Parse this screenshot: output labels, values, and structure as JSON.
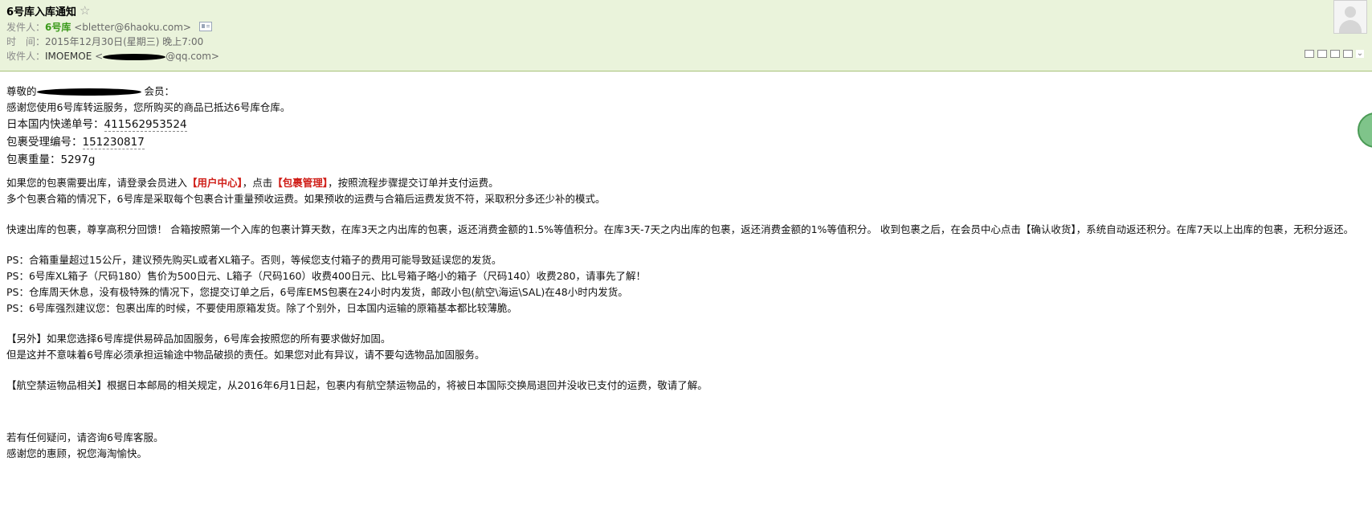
{
  "header": {
    "subject": "6号库入库通知",
    "star_icon": "☆",
    "from_label": "发件人：",
    "sender_name": "6号库",
    "sender_email": "<bletter@6haoku.com>",
    "time_label": "时　间：",
    "time_value": "2015年12月30日(星期三) 晚上7:00",
    "to_label": "收件人：",
    "recipient_name": "IMOEMOE",
    "recipient_email_prefix": "<",
    "recipient_email_suffix": "@qq.com>",
    "toolbar_icons": [
      "expand-icon",
      "window-icon",
      "print-icon",
      "more-caret-icon"
    ]
  },
  "body": {
    "greeting_prefix": "尊敬的",
    "greeting_suffix": " 会员：",
    "line_thanks": "感谢您使用6号库转运服务，您所购买的商品已抵达6号库仓库。",
    "tracking_label": "日本国内快递单号：",
    "tracking_number": "411562953524",
    "parcel_id_label": "包裹受理编号：",
    "parcel_id": "151230817",
    "weight_label": "包裹重量：",
    "weight": "5297g",
    "p1_a": "如果您的包裹需要出库，请登录会员进入",
    "p1_link1": "【用户中心】",
    "p1_b": "，点击",
    "p1_link2": "【包裹管理】",
    "p1_c": "，按照流程步骤提交订单并支付运费。",
    "p2": "多个包裹合箱的情况下，6号库是采取每个包裹合计重量预收运费。如果预收的运费与合箱后运费发货不符，采取积分多还少补的模式。",
    "p3": "快速出库的包裹，尊享高积分回馈！ 合箱按照第一个入库的包裹计算天数，在库3天之内出库的包裹，返还消费金额的1.5%等值积分。在库3天-7天之内出库的包裹，返还消费金额的1%等值积分。 收到包裹之后，在会员中心点击【确认收货】，系统自动返还积分。在库7天以上出库的包裹，无积分返还。",
    "ps1": "PS：合箱重量超过15公斤，建议预先购买L或者XL箱子。否则，等候您支付箱子的费用可能导致延误您的发货。",
    "ps2": "PS：6号库XL箱子（尺码180）售价为500日元、L箱子（尺码160）收费400日元、比L号箱子略小的箱子（尺码140）收费280，请事先了解！",
    "ps3": "PS：仓库周天休息，没有极特殊的情况下，您提交订单之后，6号库EMS包裹在24小时内发货，邮政小包(航空\\海运\\SAL)在48小时内发货。",
    "ps4": "PS：6号库强烈建议您：包裹出库的时候，不要使用原箱发货。除了个别外，日本国内运输的原箱基本都比较薄脆。",
    "other1": "【另外】如果您选择6号库提供易碎品加固服务，6号库会按照您的所有要求做好加固。",
    "other2": "但是这并不意味着6号库必须承担运输途中物品破损的责任。如果您对此有异议，请不要勾选物品加固服务。",
    "air": "【航空禁运物品相关】根据日本邮局的相关规定，从2016年6月1日起，包裹内有航空禁运物品的，将被日本国际交换局退回并没收已支付的运费，敬请了解。",
    "closing1": "若有任何疑问，请咨询6号库客服。",
    "closing2": "感谢您的惠顾，祝您海淘愉快。"
  }
}
